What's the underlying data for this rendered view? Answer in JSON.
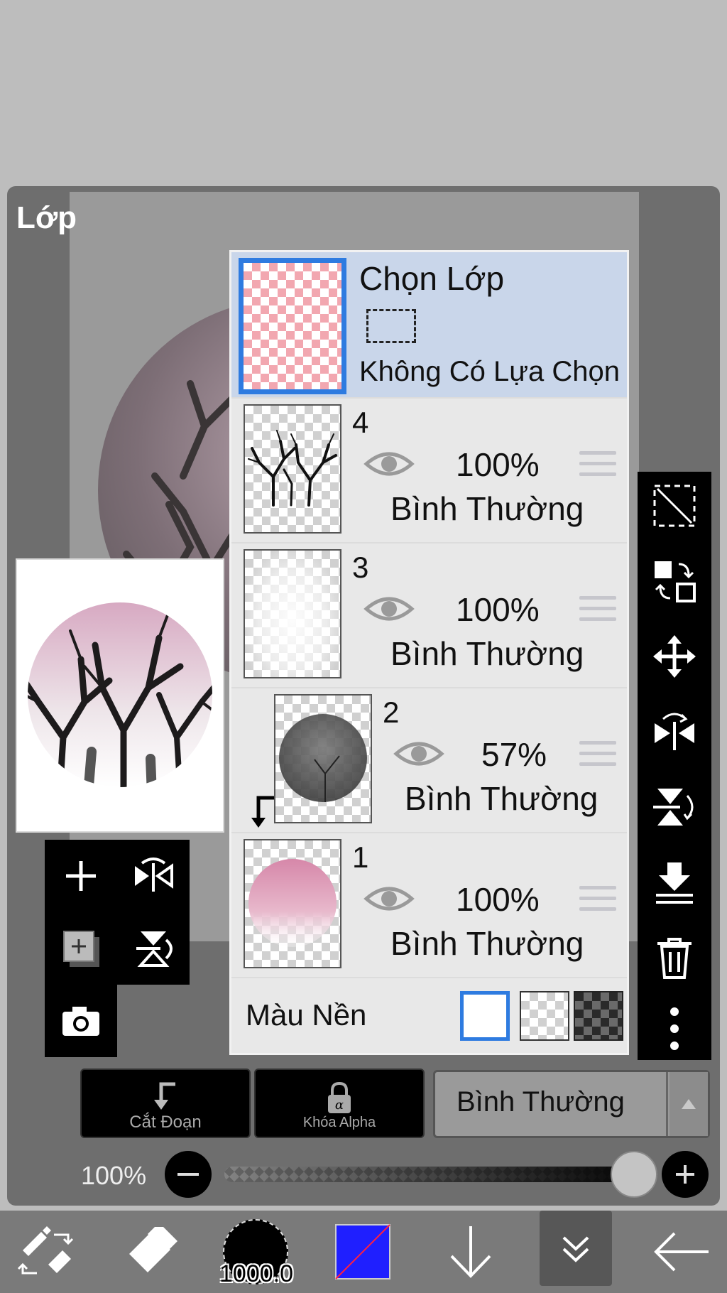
{
  "panel": {
    "title": "Lớp"
  },
  "selection_layer": {
    "title": "Chọn Lớp",
    "status": "Không Có Lựa Chọn"
  },
  "layers": [
    {
      "number": "4",
      "opacity": "100%",
      "blend": "Bình Thường",
      "visible": true
    },
    {
      "number": "3",
      "opacity": "100%",
      "blend": "Bình Thường",
      "visible": true
    },
    {
      "number": "2",
      "opacity": "57%",
      "blend": "Bình Thường",
      "visible": true,
      "clipped": true
    },
    {
      "number": "1",
      "opacity": "100%",
      "blend": "Bình Thường",
      "visible": true
    }
  ],
  "background_color": {
    "label": "Màu Nền",
    "options": [
      "white",
      "transparent",
      "dark-checker"
    ],
    "selected": "white"
  },
  "controls": {
    "clipping_label": "Cắt Đoạn",
    "alpha_lock_label": "Khóa Alpha",
    "blend_mode": "Bình Thường",
    "opacity_label": "100%",
    "opacity_value": 1.0
  },
  "bottom_bar": {
    "brush_size": "1000.0",
    "primary_color": "#1f1fff"
  },
  "colors": {
    "selection_highlight": "#c9d6ea",
    "accent_blue": "#2e7be0"
  }
}
